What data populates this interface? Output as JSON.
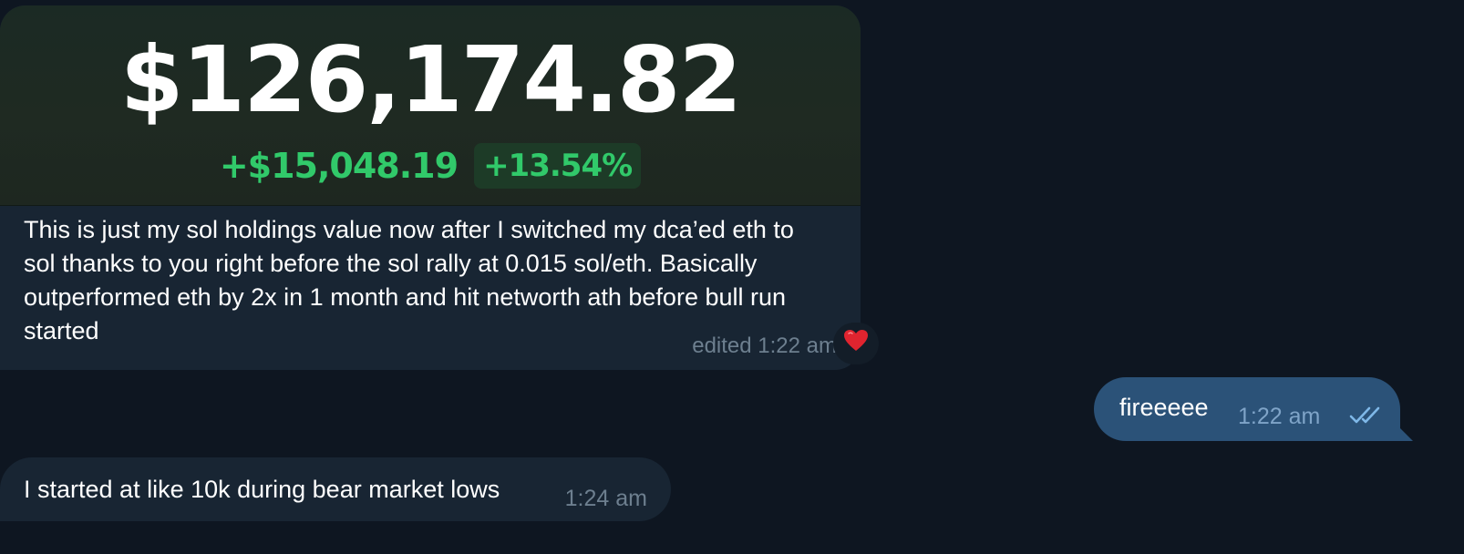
{
  "messages": {
    "first": {
      "image": {
        "amount": "$126,174.82",
        "change_abs": "+$15,048.19",
        "change_pct": "+13.54%"
      },
      "caption": "This is just my sol holdings value now after I switched my dca’ed eth to sol thanks to you right before the sol rally at 0.015 sol/eth. Basically outperformed eth by 2x in 1 month and hit networth ath before bull run started",
      "meta": "edited 1:22 am",
      "reaction": "heart-icon"
    },
    "reply": {
      "text": "fireeeee",
      "time": "1:22 am",
      "status_icon": "double-check-icon"
    },
    "second": {
      "text": "I started at like 10k during bear market lows",
      "time": "1:24 am"
    }
  },
  "colors": {
    "background": "#0e1621",
    "incoming_bubble": "#182533",
    "outgoing_bubble": "#2b5278",
    "gain_green": "#31c96a",
    "reaction_heart": "#e0242f"
  }
}
